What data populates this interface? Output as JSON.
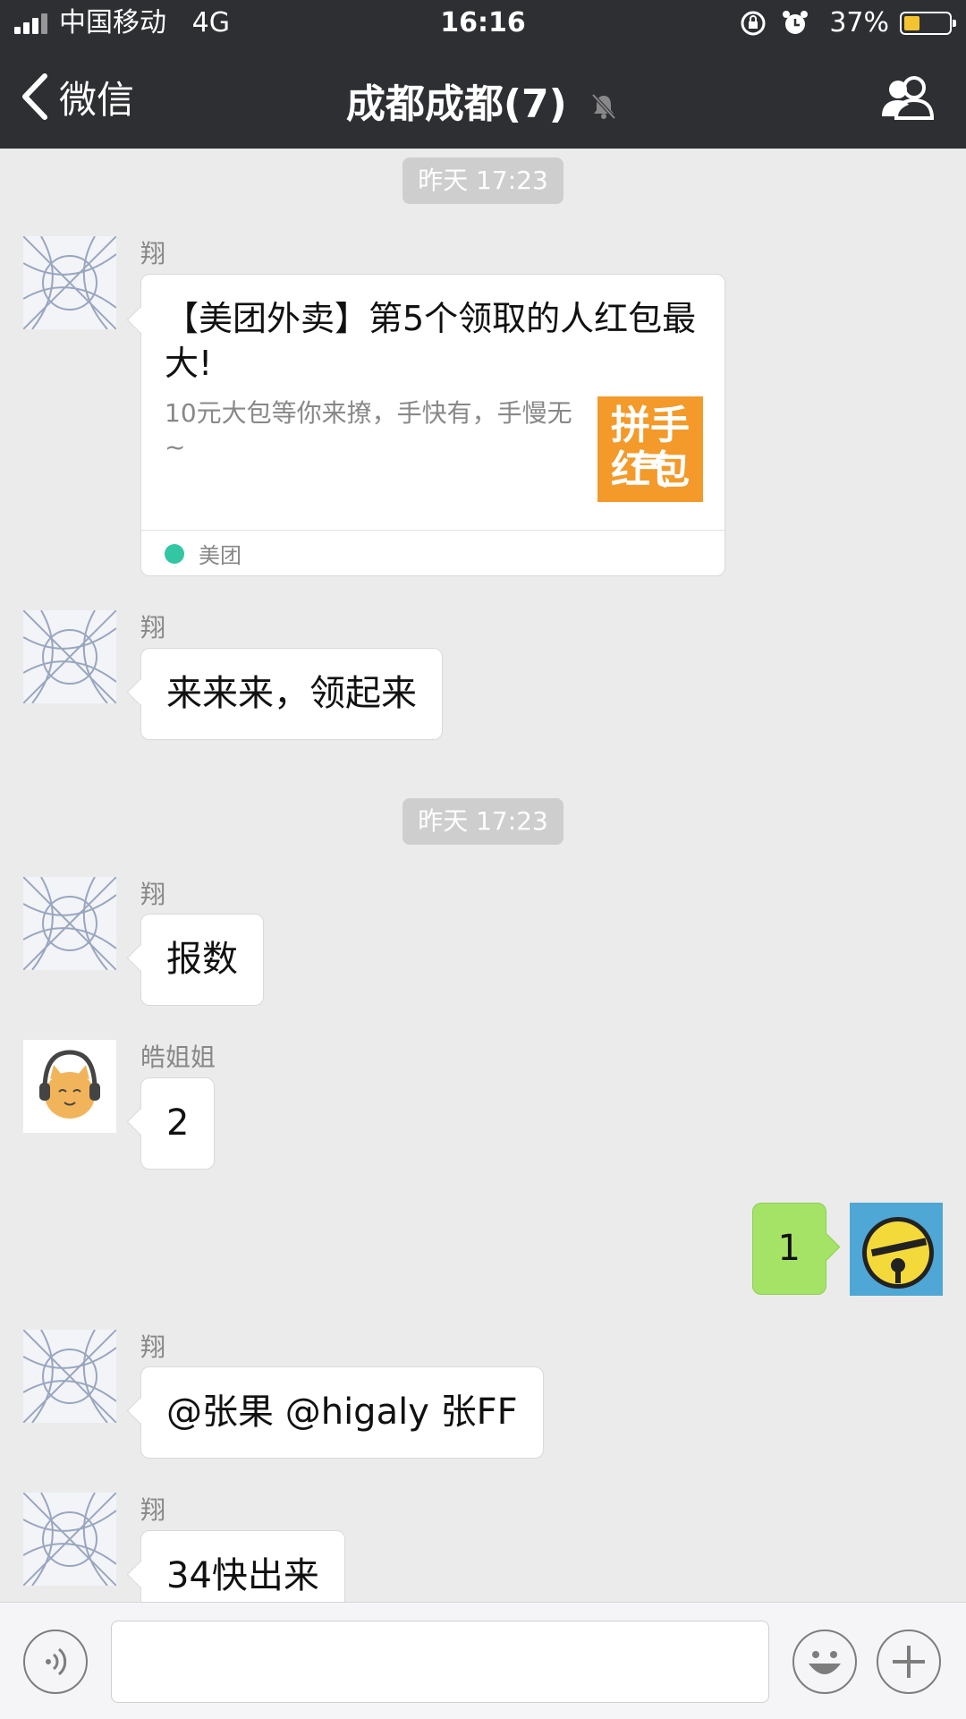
{
  "status_bar": {
    "carrier": "中国移动",
    "network": "4G",
    "time": "16:16",
    "battery_percent": "37%",
    "battery_level": 0.37
  },
  "nav": {
    "back_label": "微信",
    "title": "成都成都(7)"
  },
  "timestamps": [
    "昨天 17:23",
    "昨天 17:23"
  ],
  "messages": [
    {
      "sender": "翔",
      "type": "link_card",
      "title": "【美团外卖】第5个领取的人红包最大!",
      "description": "10元大包等你来撩，手快有，手慢无~",
      "thumb_text": [
        "拼手气",
        "红包"
      ],
      "source": "美团"
    },
    {
      "sender": "翔",
      "text": "来来来，领起来"
    },
    {
      "sender": "翔",
      "text": "报数"
    },
    {
      "sender": "皓姐姐",
      "text": "2"
    },
    {
      "sender": "",
      "text": "1",
      "from_me": true
    },
    {
      "sender": "翔",
      "text": "@张果 @higaly 张FF"
    },
    {
      "sender": "翔",
      "text": "34快出来"
    }
  ],
  "input": {
    "placeholder": ""
  },
  "colors": {
    "nav_bg": "#2e2f33",
    "chat_bg": "#ebebeb",
    "my_bubble": "#a5e367",
    "battery": "#f4c430"
  }
}
